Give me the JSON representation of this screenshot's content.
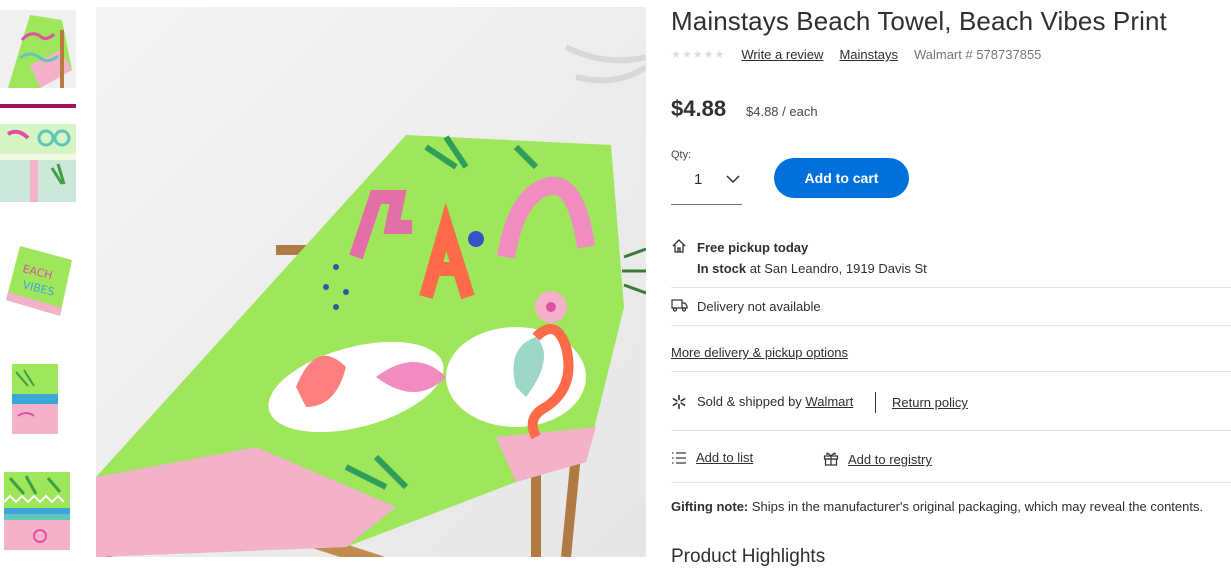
{
  "product": {
    "title": "Mainstays Beach Towel, Beach Vibes Print",
    "write_review": "Write a review",
    "brand": "Mainstays",
    "sku": "Walmart # 578737855",
    "price": "$4.88",
    "unit_price": "$4.88 / each",
    "rating_stars": "★★★★★",
    "rating_value": 0
  },
  "purchase": {
    "qty_label": "Qty:",
    "qty_value": "1",
    "add_to_cart": "Add to cart"
  },
  "fulfillment": {
    "pickup_title": "Free pickup today",
    "stock_label": "In stock",
    "stock_location": " at San Leandro, 1919 Davis St",
    "delivery": "Delivery not available",
    "more_options": "More delivery & pickup options"
  },
  "seller": {
    "sold_by": "Sold & shipped by",
    "seller_name": "Walmart",
    "return_policy": "Return policy"
  },
  "actions": {
    "add_to_list": "Add to list",
    "add_to_registry": "Add to registry"
  },
  "gifting": {
    "label": "Gifting note:",
    "text": " Ships in the manufacturer's original packaging, which may reveal the contents."
  },
  "section_heading": "Product Highlights",
  "colors": {
    "accent": "#0071dc",
    "active_thumb": "#a3125a",
    "towel_green": "#9ee65a"
  },
  "icons": [
    "home-pickup-icon",
    "truck-icon",
    "walmart-spark-icon",
    "list-icon",
    "gift-icon",
    "chevron-down-icon"
  ]
}
